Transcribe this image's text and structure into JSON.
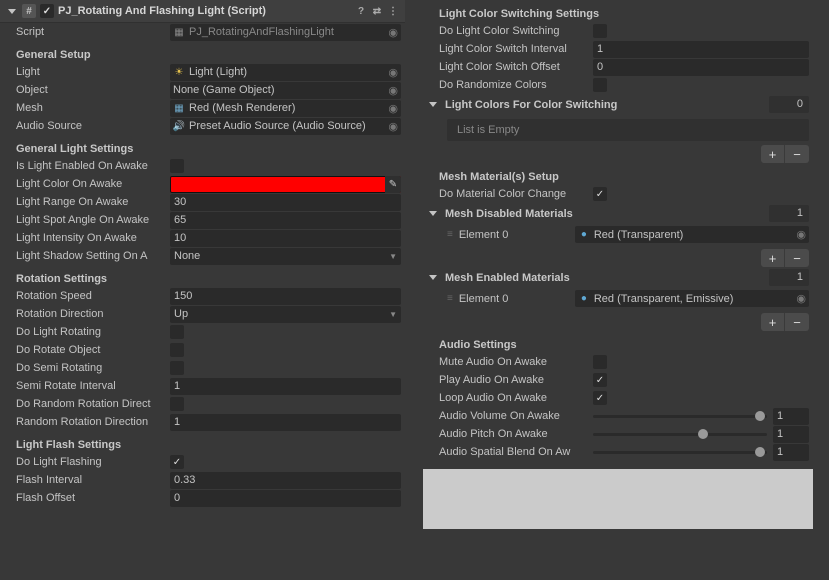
{
  "header": {
    "title": "PJ_Rotating And Flashing Light (Script)",
    "checked": true
  },
  "scriptRow": {
    "label": "Script",
    "value": "PJ_RotatingAndFlashingLight"
  },
  "sections": {
    "general_setup": "General Setup",
    "general_light": "General Light Settings",
    "rotation": "Rotation Settings",
    "flash": "Light Flash Settings",
    "colorSwitch": "Light Color Switching Settings",
    "meshSetup": "Mesh Material(s) Setup",
    "audio": "Audio Settings"
  },
  "gs": {
    "light": {
      "label": "Light",
      "value": "Light (Light)"
    },
    "object": {
      "label": "Object",
      "value": "None (Game Object)"
    },
    "mesh": {
      "label": "Mesh",
      "value": "Red (Mesh Renderer)"
    },
    "audio": {
      "label": "Audio Source",
      "value": "Preset Audio Source (Audio Source)"
    }
  },
  "gl": {
    "enabled": {
      "label": "Is Light Enabled On Awake",
      "value": false
    },
    "color": {
      "label": "Light Color On Awake",
      "hex": "#ff0000"
    },
    "range": {
      "label": "Light Range On Awake",
      "value": "30"
    },
    "spot": {
      "label": "Light Spot Angle On Awake",
      "value": "65"
    },
    "intensity": {
      "label": "Light Intensity On Awake",
      "value": "10"
    },
    "shadow": {
      "label": "Light Shadow Setting On A",
      "value": "None"
    }
  },
  "rot": {
    "speed": {
      "label": "Rotation Speed",
      "value": "150"
    },
    "dir": {
      "label": "Rotation Direction",
      "value": "Up"
    },
    "doLight": {
      "label": "Do Light Rotating",
      "value": false
    },
    "doObj": {
      "label": "Do Rotate Object",
      "value": false
    },
    "doSemi": {
      "label": "Do Semi Rotating",
      "value": false
    },
    "semiInt": {
      "label": "Semi Rotate Interval",
      "value": "1"
    },
    "doRand": {
      "label": "Do Random Rotation Direct",
      "value": false
    },
    "randInt": {
      "label": "Random Rotation Direction",
      "value": "1"
    }
  },
  "flash": {
    "do": {
      "label": "Do Light Flashing",
      "value": true
    },
    "interval": {
      "label": "Flash Interval",
      "value": "0.33"
    },
    "offset": {
      "label": "Flash Offset",
      "value": "0"
    }
  },
  "cs": {
    "do": {
      "label": "Do Light Color Switching",
      "value": false
    },
    "interval": {
      "label": "Light Color Switch Interval",
      "value": "1"
    },
    "offset": {
      "label": "Light Color Switch Offset",
      "value": "0"
    },
    "rand": {
      "label": "Do Randomize Colors",
      "value": false
    },
    "listTitle": "Light Colors For Color Switching",
    "listCount": "0",
    "emptyText": "List is Empty"
  },
  "mesh": {
    "doChange": {
      "label": "Do Material Color Change",
      "value": true
    },
    "disabledTitle": "Mesh Disabled Materials",
    "disabledCount": "1",
    "disabledEl0Label": "Element 0",
    "disabledEl0Value": "Red (Transparent)",
    "enabledTitle": "Mesh Enabled Materials",
    "enabledCount": "1",
    "enabledEl0Label": "Element 0",
    "enabledEl0Value": "Red (Transparent, Emissive)"
  },
  "audio": {
    "mute": {
      "label": "Mute Audio On Awake",
      "value": false
    },
    "play": {
      "label": "Play Audio On Awake",
      "value": true
    },
    "loop": {
      "label": "Loop Audio On Awake",
      "value": true
    },
    "volume": {
      "label": "Audio Volume On Awake",
      "value": "1",
      "pos": 96
    },
    "pitch": {
      "label": "Audio Pitch On Awake",
      "value": "1",
      "pos": 63
    },
    "spatial": {
      "label": "Audio Spatial Blend On Aw",
      "value": "1",
      "pos": 96
    }
  }
}
